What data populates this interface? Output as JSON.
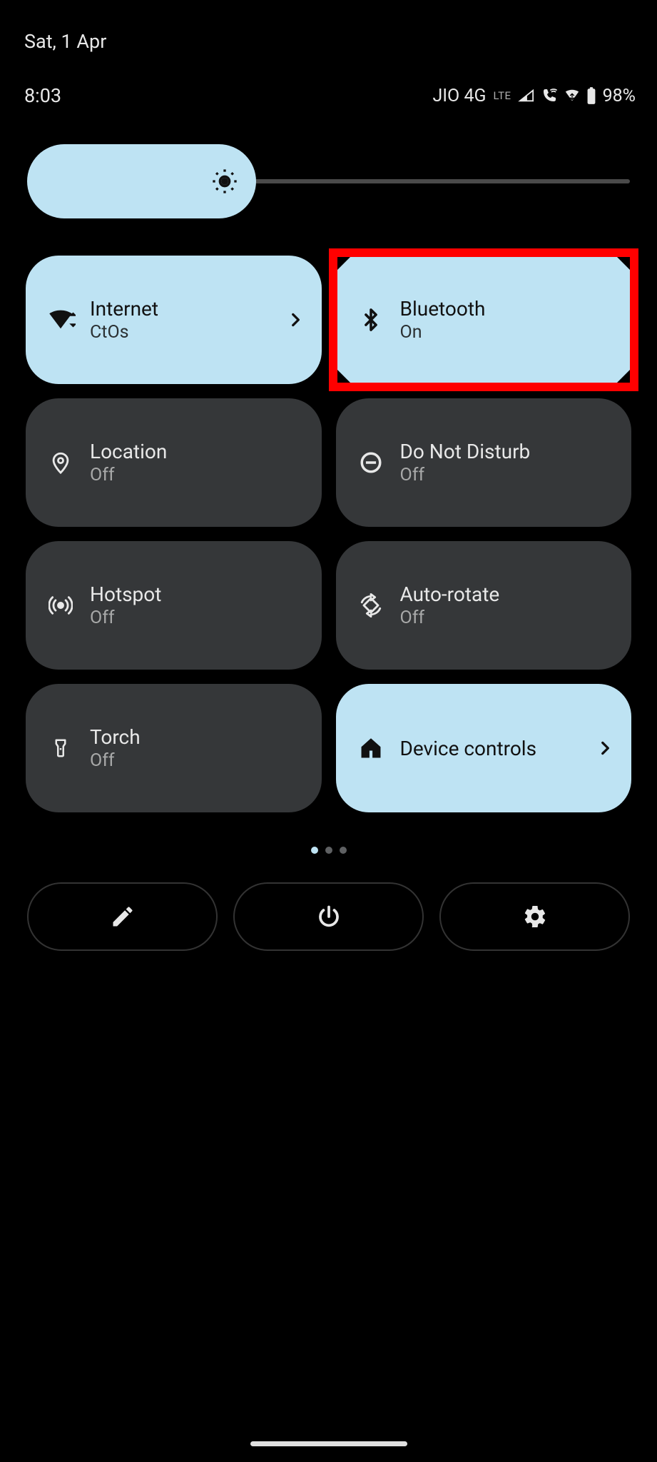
{
  "date": "Sat, 1 Apr",
  "status": {
    "time": "8:03",
    "carrier": "JIO 4G",
    "network_badge": "LTE",
    "battery_percent": "98%"
  },
  "brightness": {
    "percent": 38
  },
  "tiles": {
    "internet": {
      "title": "Internet",
      "sub": "CtOs",
      "active": true,
      "chevron": true
    },
    "bluetooth": {
      "title": "Bluetooth",
      "sub": "On",
      "active": true,
      "highlighted": true
    },
    "location": {
      "title": "Location",
      "sub": "Off",
      "active": false
    },
    "dnd": {
      "title": "Do Not Disturb",
      "sub": "Off",
      "active": false
    },
    "hotspot": {
      "title": "Hotspot",
      "sub": "Off",
      "active": false
    },
    "autorotate": {
      "title": "Auto-rotate",
      "sub": "Off",
      "active": false
    },
    "torch": {
      "title": "Torch",
      "sub": "Off",
      "active": false
    },
    "device": {
      "title": "Device controls",
      "sub": "",
      "active": true,
      "chevron": true
    }
  },
  "pager": {
    "count": 3,
    "active_index": 0
  }
}
